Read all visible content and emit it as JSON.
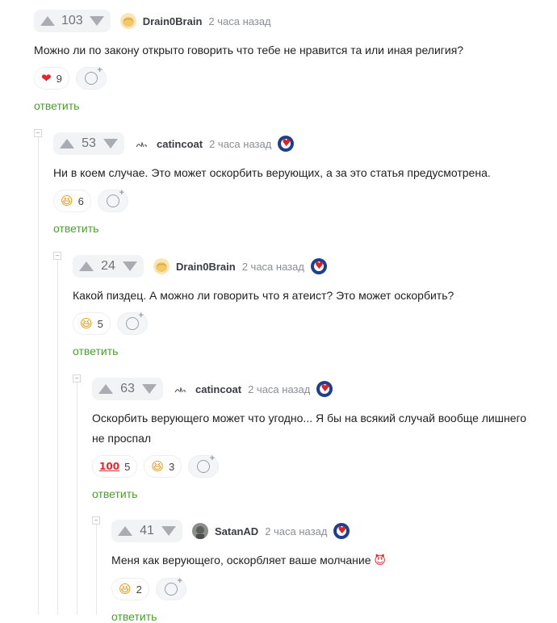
{
  "comments": [
    {
      "rating": "103",
      "author": "Drain0Brain",
      "time": "2 часа назад",
      "text": "Можно ли по закону открыто говорить что тебе не нравится та или иная религия?",
      "reactions": [
        {
          "icon": "heart-icon",
          "glyph": "❤",
          "count": "9"
        }
      ],
      "reply_label": "ответить"
    },
    {
      "rating": "53",
      "author": "catincoat",
      "time": "2 часа назад",
      "text": "Ни в коем случае. Это может оскорбить верующих, а за это статья предусмотрена.",
      "reactions": [
        {
          "icon": "laughing-face-icon",
          "glyph": "😆",
          "count": "6"
        }
      ],
      "reply_label": "ответить"
    },
    {
      "rating": "24",
      "author": "Drain0Brain",
      "time": "2 часа назад",
      "text": "Какой пиздец. А можно ли говорить что я атеист? Это может оскорбить?",
      "reactions": [
        {
          "icon": "laughing-face-icon",
          "glyph": "😆",
          "count": "5"
        }
      ],
      "reply_label": "ответить"
    },
    {
      "rating": "63",
      "author": "catincoat",
      "time": "2 часа назад",
      "text": "Оскорбить верующего может что угодно... Я бы на всякий случай вообще лишнего не проспал",
      "reactions": [
        {
          "icon": "hundred-points-icon",
          "glyph": "100",
          "count": "5"
        },
        {
          "icon": "laughing-face-icon",
          "glyph": "😆",
          "count": "3"
        }
      ],
      "reply_label": "ответить"
    },
    {
      "rating": "41",
      "author": "SatanAD",
      "time": "2 часа назад",
      "text": "Меня как верующего, оскорбляет ваше молчание",
      "text_emoji": "😈",
      "reactions": [
        {
          "icon": "laughing-face-icon",
          "glyph": "😆",
          "count": "2"
        }
      ],
      "reply_label": "ответить"
    }
  ],
  "colors": {
    "reply": "#4aa02c",
    "vote_bg": "#f2f3f5",
    "arrow": "#a9adb3"
  }
}
